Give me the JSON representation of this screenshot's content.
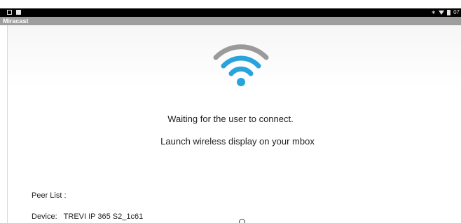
{
  "status_bar": {
    "icons_left": [
      "screenshot-icon",
      "notification-icon"
    ],
    "icons_right": [
      "bluetooth-icon",
      "wifi-signal-icon",
      "battery-icon"
    ],
    "time": "07"
  },
  "app": {
    "title": "Miracast"
  },
  "main": {
    "wifi_icon": "wifi-icon",
    "colors": {
      "wifi_grey": "#9a9a9a",
      "wifi_blue": "#29a3dc"
    },
    "message_waiting": "Waiting for the user to connect.",
    "message_launch": "Launch wireless display on your mbox"
  },
  "peer_list": {
    "label": "Peer List :",
    "devices": [
      {
        "prefix": "Device:",
        "name": "TREVI IP 365 S2_1c61"
      }
    ]
  }
}
